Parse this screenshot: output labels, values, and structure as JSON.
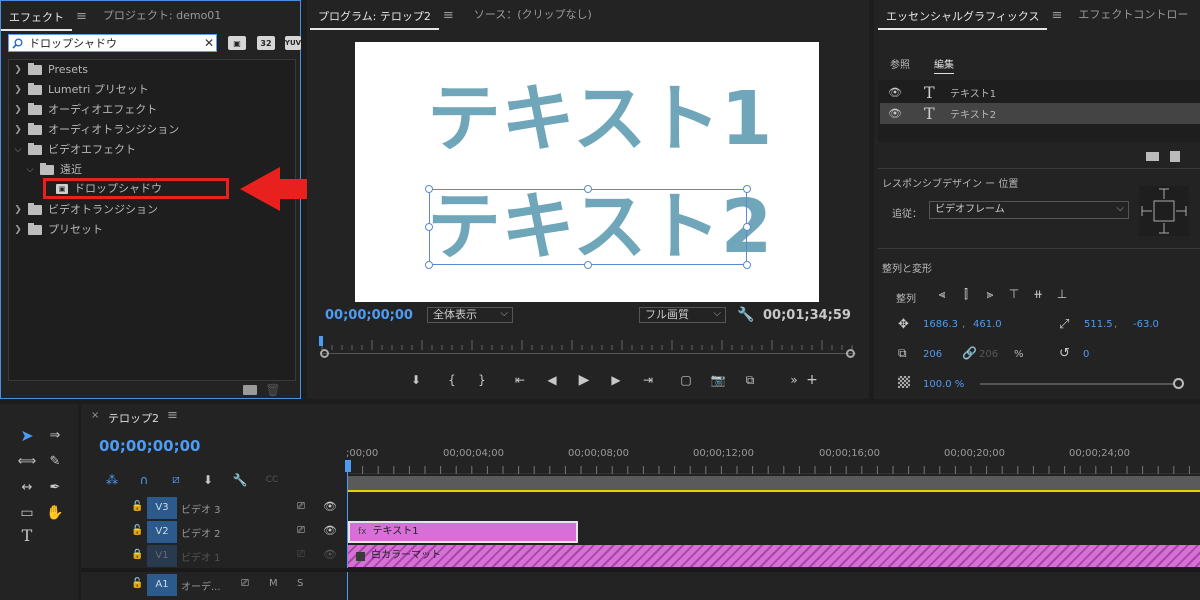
{
  "effects_panel": {
    "tab_effects": "エフェクト",
    "tab_project": "プロジェクト: demo01",
    "search_value": "ドロップシャドウ",
    "icon_labels": [
      "32",
      "YUV"
    ],
    "tree": [
      {
        "label": "Presets",
        "depth": 0,
        "expanded": false
      },
      {
        "label": "Lumetri プリセット",
        "depth": 0,
        "expanded": false
      },
      {
        "label": "オーディオエフェクト",
        "depth": 0,
        "expanded": false
      },
      {
        "label": "オーディオトランジション",
        "depth": 0,
        "expanded": false
      },
      {
        "label": "ビデオエフェクト",
        "depth": 0,
        "expanded": true
      },
      {
        "label": "遠近",
        "depth": 1,
        "expanded": true
      },
      {
        "label": "ドロップシャドウ",
        "depth": 2,
        "highlighted": true
      },
      {
        "label": "ビデオトランジション",
        "depth": 0,
        "expanded": false
      },
      {
        "label": "プリセット",
        "depth": 0,
        "expanded": false
      }
    ]
  },
  "program_monitor": {
    "tab_program": "プログラム: テロップ2",
    "tab_source": "ソース：(クリップなし)",
    "preview_text_1": "テキスト1",
    "preview_text_2": "テキスト2",
    "timecode_current": "00;00;00;00",
    "zoom_select": "全体表示",
    "quality_select": "フル画質",
    "timecode_duration": "00;01;34;59"
  },
  "essential_graphics": {
    "tab_eg": "エッセンシャルグラフィックス",
    "tab_effect_controls": "エフェクトコントロー",
    "subtab_browse": "参照",
    "subtab_edit": "編集",
    "layers": [
      "テキスト1",
      "テキスト2"
    ],
    "responsive_title": "レスポンシブデザイン ー 位置",
    "follow_label": "追従：",
    "follow_value": "ビデオフレーム",
    "align_title": "整列と変形",
    "align_label": "整列",
    "position_x": "1686.3",
    "position_y": "461.0",
    "anchor_x": "511.5",
    "anchor_y": "-63.0",
    "scale_value": "206",
    "scale_linked": "206",
    "scale_unit": "%",
    "rotation_value": "0",
    "opacity_value": "100.0 %"
  },
  "timeline": {
    "sequence_name": "テロップ2",
    "timecode": "00;00;00;00",
    "ruler_labels": [
      ";00;00",
      "00;00;04;00",
      "00;00;08;00",
      "00;00;12;00",
      "00;00;16;00",
      "00;00;20;00",
      "00;00;24;00"
    ],
    "tracks": [
      {
        "id": "V3",
        "name": "ビデオ 3",
        "locked": false
      },
      {
        "id": "V2",
        "name": "ビデオ 2",
        "locked": false
      },
      {
        "id": "V1",
        "name": "ビデオ 1",
        "locked": true
      },
      {
        "id": "A1",
        "name": "オーデ...",
        "locked": false
      }
    ],
    "track_buttons_audio": [
      "M",
      "S"
    ],
    "clips": [
      {
        "label": "テキスト1",
        "track": "V2"
      },
      {
        "label": "白カラーマット",
        "track": "V1"
      }
    ],
    "colors": {
      "clip": "#d86fd8",
      "track_header": "#2c5a8a",
      "accent": "#4e9bf2",
      "highlight_red": "#e8211e"
    }
  }
}
